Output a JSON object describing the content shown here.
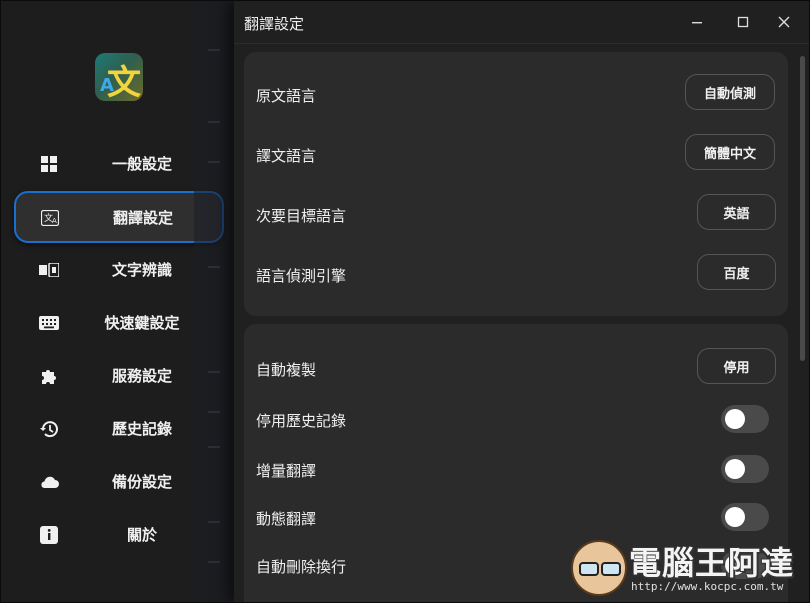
{
  "colors": {
    "accent": "#1a6fcf",
    "sidebar_bg": "#1d1d1d",
    "card_bg": "#2b2b2b",
    "toggle_off": "#4a4a4a"
  },
  "logo": {
    "big_glyph": "文",
    "small_glyph": "A"
  },
  "sidebar": {
    "items": [
      {
        "label": "一般設定",
        "icon": "grid-icon"
      },
      {
        "label": "翻譯設定",
        "icon": "translate-icon",
        "active": true
      },
      {
        "label": "文字辨識",
        "icon": "ocr-icon"
      },
      {
        "label": "快速鍵設定",
        "icon": "keyboard-icon"
      },
      {
        "label": "服務設定",
        "icon": "puzzle-icon"
      },
      {
        "label": "歷史記錄",
        "icon": "history-icon"
      },
      {
        "label": "備份設定",
        "icon": "cloud-icon"
      },
      {
        "label": "關於",
        "icon": "info-icon"
      }
    ]
  },
  "dialog": {
    "title": "翻譯設定",
    "controls": {
      "minimize": "—",
      "maximize": "☐",
      "close": "✕"
    },
    "section1": [
      {
        "label": "原文語言",
        "value": "自動偵測"
      },
      {
        "label": "譯文語言",
        "value": "簡體中文"
      },
      {
        "label": "次要目標語言",
        "value": "英語"
      },
      {
        "label": "語言偵測引擎",
        "value": "百度"
      }
    ],
    "section2": [
      {
        "label": "自動複製",
        "value": "停用",
        "type": "select"
      },
      {
        "label": "停用歷史記錄",
        "type": "toggle",
        "on": false
      },
      {
        "label": "增量翻譯",
        "type": "toggle",
        "on": false
      },
      {
        "label": "動態翻譯",
        "type": "toggle",
        "on": false
      },
      {
        "label": "自動刪除換行",
        "type": "toggle",
        "on": false
      }
    ]
  },
  "watermark": {
    "text": "電腦王阿達",
    "url": "http://www.kocpc.com.tw"
  }
}
